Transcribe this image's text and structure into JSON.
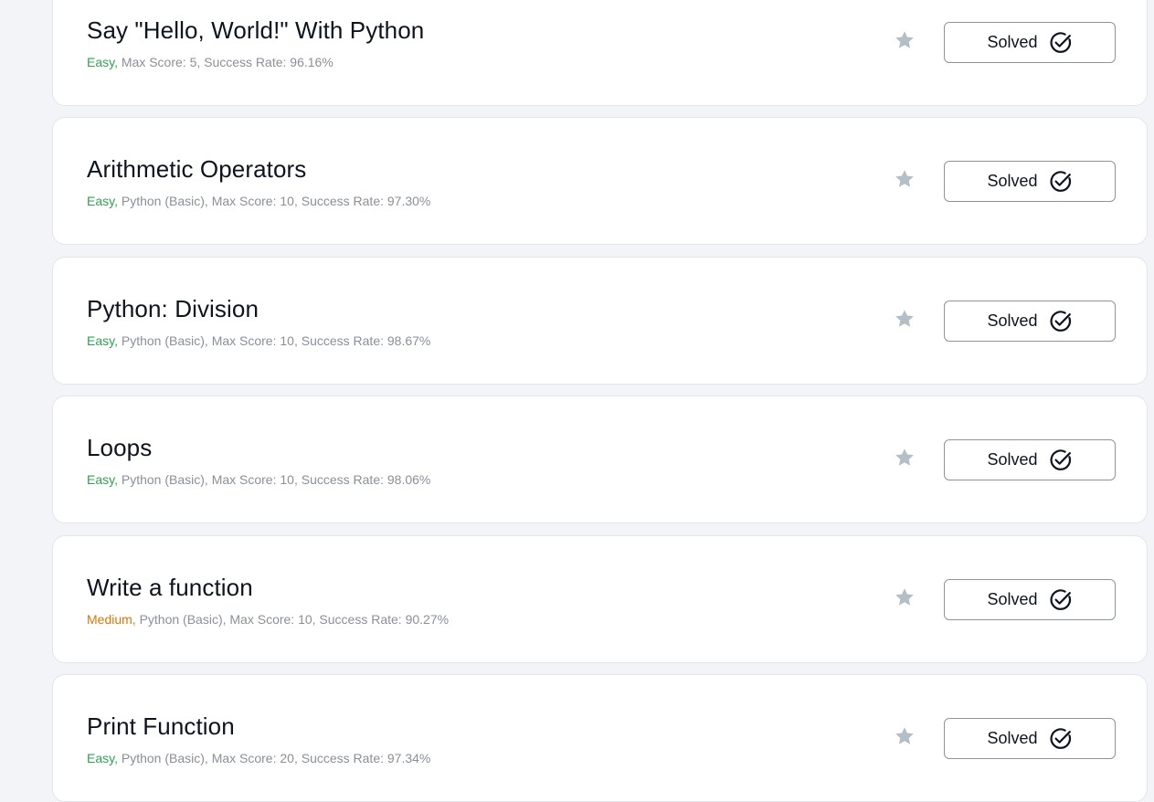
{
  "challenges": [
    {
      "title": "Say \"Hello, World!\" With Python",
      "difficulty": "Easy,",
      "difficulty_level": "easy",
      "details": " Max Score: 5, Success Rate: 96.16%",
      "status_label": "Solved",
      "star_icon": "star-icon",
      "status_icon": "check-circle-icon"
    },
    {
      "title": "Arithmetic Operators",
      "difficulty": "Easy,",
      "difficulty_level": "easy",
      "details": " Python (Basic), Max Score: 10, Success Rate: 97.30%",
      "status_label": "Solved",
      "star_icon": "star-icon",
      "status_icon": "check-circle-icon"
    },
    {
      "title": "Python: Division",
      "difficulty": "Easy,",
      "difficulty_level": "easy",
      "details": " Python (Basic), Max Score: 10, Success Rate: 98.67%",
      "status_label": "Solved",
      "star_icon": "star-icon",
      "status_icon": "check-circle-icon"
    },
    {
      "title": "Loops",
      "difficulty": "Easy,",
      "difficulty_level": "easy",
      "details": " Python (Basic), Max Score: 10, Success Rate: 98.06%",
      "status_label": "Solved",
      "star_icon": "star-icon",
      "status_icon": "check-circle-icon"
    },
    {
      "title": "Write a function",
      "difficulty": "Medium,",
      "difficulty_level": "medium",
      "details": " Python (Basic), Max Score: 10, Success Rate: 90.27%",
      "status_label": "Solved",
      "star_icon": "star-icon",
      "status_icon": "check-circle-icon"
    },
    {
      "title": "Print Function",
      "difficulty": "Easy,",
      "difficulty_level": "easy",
      "details": " Python (Basic), Max Score: 20, Success Rate: 97.34%",
      "status_label": "Solved",
      "star_icon": "star-icon",
      "status_icon": "check-circle-icon"
    }
  ],
  "colors": {
    "page_background": "#f3f4f8",
    "card_background": "#ffffff",
    "easy": "#2ea44f",
    "medium": "#d97706",
    "meta_text": "#8a8f99",
    "star": "#b3bec6",
    "title_text": "#0e141e"
  }
}
